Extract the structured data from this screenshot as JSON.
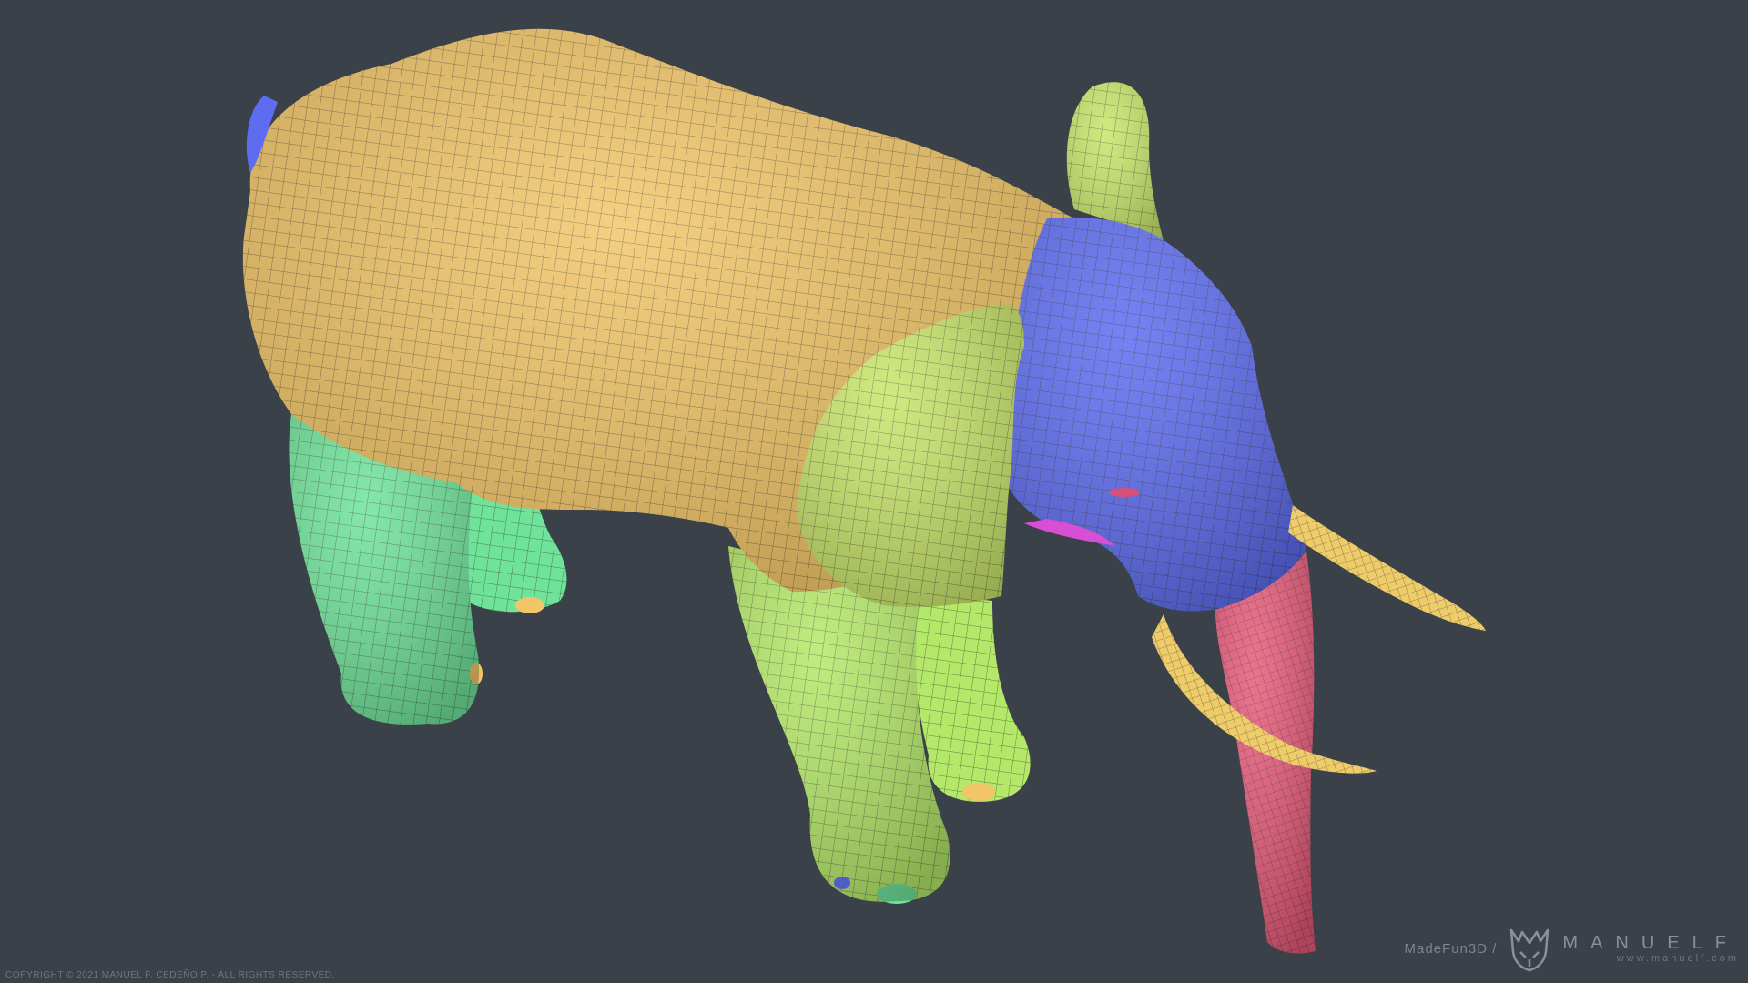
{
  "scene": {
    "subject": "elephant",
    "mesh_groups": [
      {
        "name": "body",
        "color": "#f2c566"
      },
      {
        "name": "legs-rear",
        "color": "#6fe39a"
      },
      {
        "name": "legs-front",
        "color": "#b4e868"
      },
      {
        "name": "ears",
        "color": "#c9e56a"
      },
      {
        "name": "head",
        "color": "#5d6cf0"
      },
      {
        "name": "trunk",
        "color": "#e85a7a"
      },
      {
        "name": "tusks",
        "color": "#efcc6a"
      },
      {
        "name": "mouth",
        "color": "#d84fd6"
      }
    ],
    "wireframe_color": "#2b2a1f",
    "background_color": "#3a4148"
  },
  "footer": {
    "copyright": "COPYRIGHT © 2021 MANUEL F. CEDEÑO P. - ALL RIGHTS RESERVED.",
    "studio": "MadeFun3D /",
    "brand_name": "MANUELF",
    "brand_url": "www.manuelf.com"
  }
}
